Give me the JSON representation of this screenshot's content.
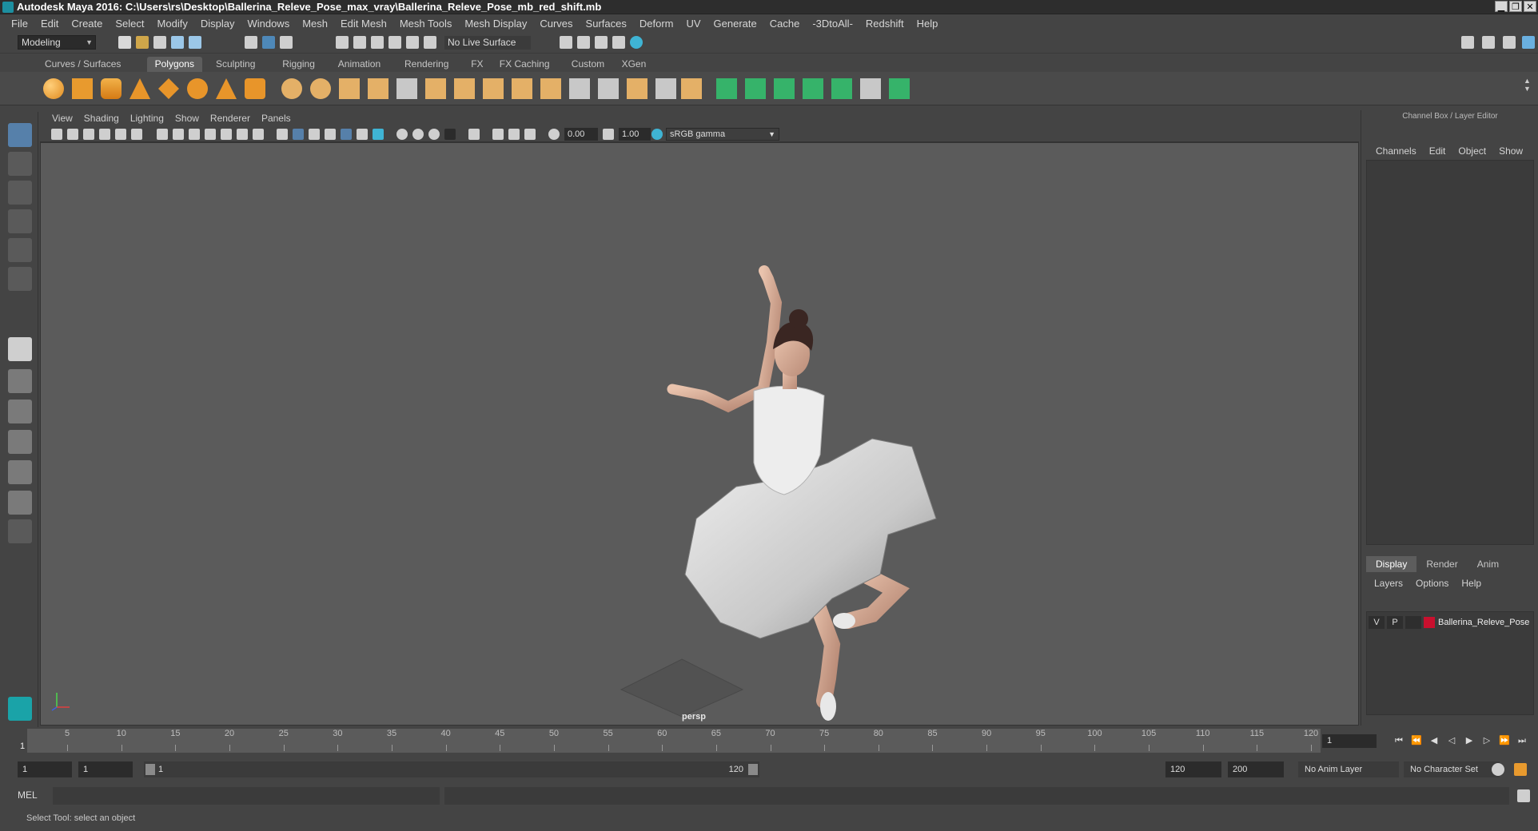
{
  "window": {
    "title": "Autodesk Maya 2016: C:\\Users\\rs\\Desktop\\Ballerina_Releve_Pose_max_vray\\Ballerina_Releve_Pose_mb_red_shift.mb",
    "min_glyph": "▁",
    "restore_glyph": "❐",
    "close_glyph": "✕"
  },
  "menubar": [
    "File",
    "Edit",
    "Create",
    "Select",
    "Modify",
    "Display",
    "Windows",
    "Mesh",
    "Edit Mesh",
    "Mesh Tools",
    "Mesh Display",
    "Curves",
    "Surfaces",
    "Deform",
    "UV",
    "Generate",
    "Cache",
    "-3DtoAll-",
    "Redshift",
    "Help"
  ],
  "statusline": {
    "mode": "Modeling",
    "live_surface": "No Live Surface"
  },
  "shelf": {
    "tabs": [
      "Curves / Surfaces",
      "Polygons",
      "Sculpting",
      "Rigging",
      "Animation",
      "Rendering",
      "FX",
      "FX Caching",
      "Custom",
      "XGen"
    ],
    "active_tab": "Polygons"
  },
  "viewport": {
    "menu": [
      "View",
      "Shading",
      "Lighting",
      "Show",
      "Renderer",
      "Panels"
    ],
    "exposure": "0.00",
    "gamma_value": "1.00",
    "color_space": "sRGB gamma",
    "camera_label": "persp",
    "bg_color": "#5b5b5b"
  },
  "channelbox": {
    "title": "Channel Box / Layer Editor",
    "menu": [
      "Channels",
      "Edit",
      "Object",
      "Show"
    ],
    "layer_tabs": [
      "Display",
      "Render",
      "Anim"
    ],
    "active_layer_tab": "Display",
    "layer_menu": [
      "Layers",
      "Options",
      "Help"
    ],
    "layer": {
      "visible": "V",
      "playback": "P",
      "name": "Ballerina_Releve_Pose",
      "color": "#c8102e"
    }
  },
  "timeslider": {
    "ticks": [
      5,
      10,
      15,
      20,
      25,
      30,
      35,
      40,
      45,
      50,
      55,
      60,
      65,
      70,
      75,
      80,
      85,
      90,
      95,
      100,
      105,
      110,
      115,
      120
    ],
    "min": 1,
    "max": 120,
    "current_frame": "1",
    "current_frame_field": "1"
  },
  "rangebar": {
    "start": "1",
    "playback_start": "1",
    "range_start_label": "1",
    "range_end_label": "120",
    "playback_end": "120",
    "end": "200",
    "anim_layer": "No Anim Layer",
    "character_set": "No Character Set"
  },
  "cmdline": {
    "label": "MEL"
  },
  "helpline": {
    "text": "Select Tool: select an object"
  }
}
